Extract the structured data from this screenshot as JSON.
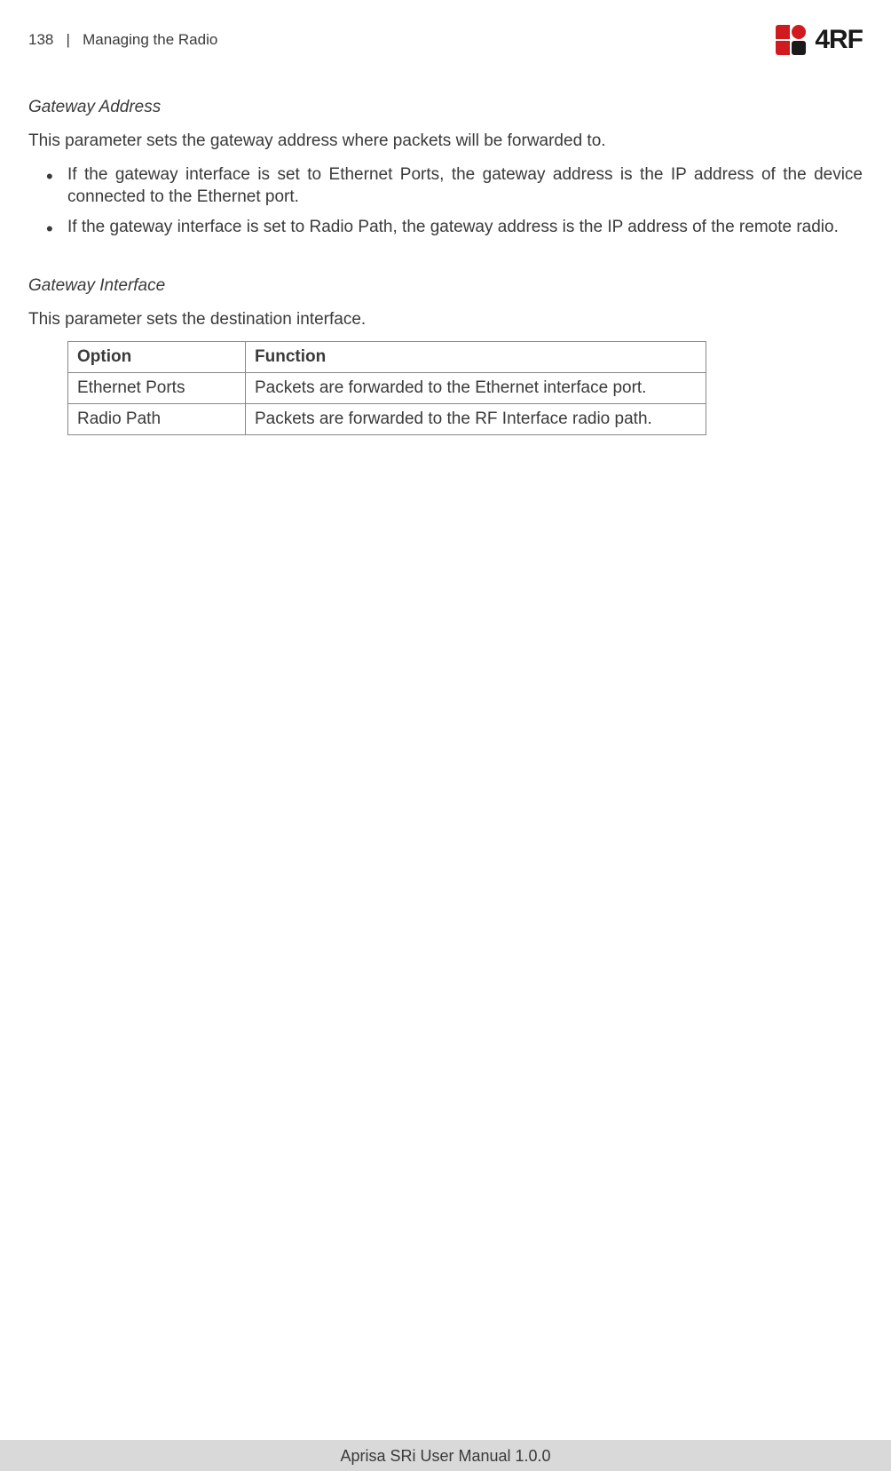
{
  "header": {
    "page_number": "138",
    "separator": "|",
    "section_title": "Managing the Radio",
    "logo_text": "4RF"
  },
  "section1": {
    "heading": "Gateway Address",
    "intro": "This parameter sets the gateway address where packets will be forwarded to.",
    "bullets": [
      "If the gateway interface is set to Ethernet Ports, the gateway address is the IP address of the device connected to the Ethernet port.",
      "If the gateway interface is set to Radio Path, the gateway address is the IP address of the remote radio."
    ]
  },
  "section2": {
    "heading": "Gateway Interface",
    "intro": "This parameter sets the destination interface.",
    "table": {
      "headers": {
        "col1": "Option",
        "col2": "Function"
      },
      "rows": [
        {
          "option": "Ethernet Ports",
          "function": "Packets are forwarded to the Ethernet interface port."
        },
        {
          "option": "Radio Path",
          "function": "Packets are forwarded to the RF Interface radio path."
        }
      ]
    }
  },
  "footer": {
    "text": "Aprisa SRi User Manual 1.0.0"
  }
}
